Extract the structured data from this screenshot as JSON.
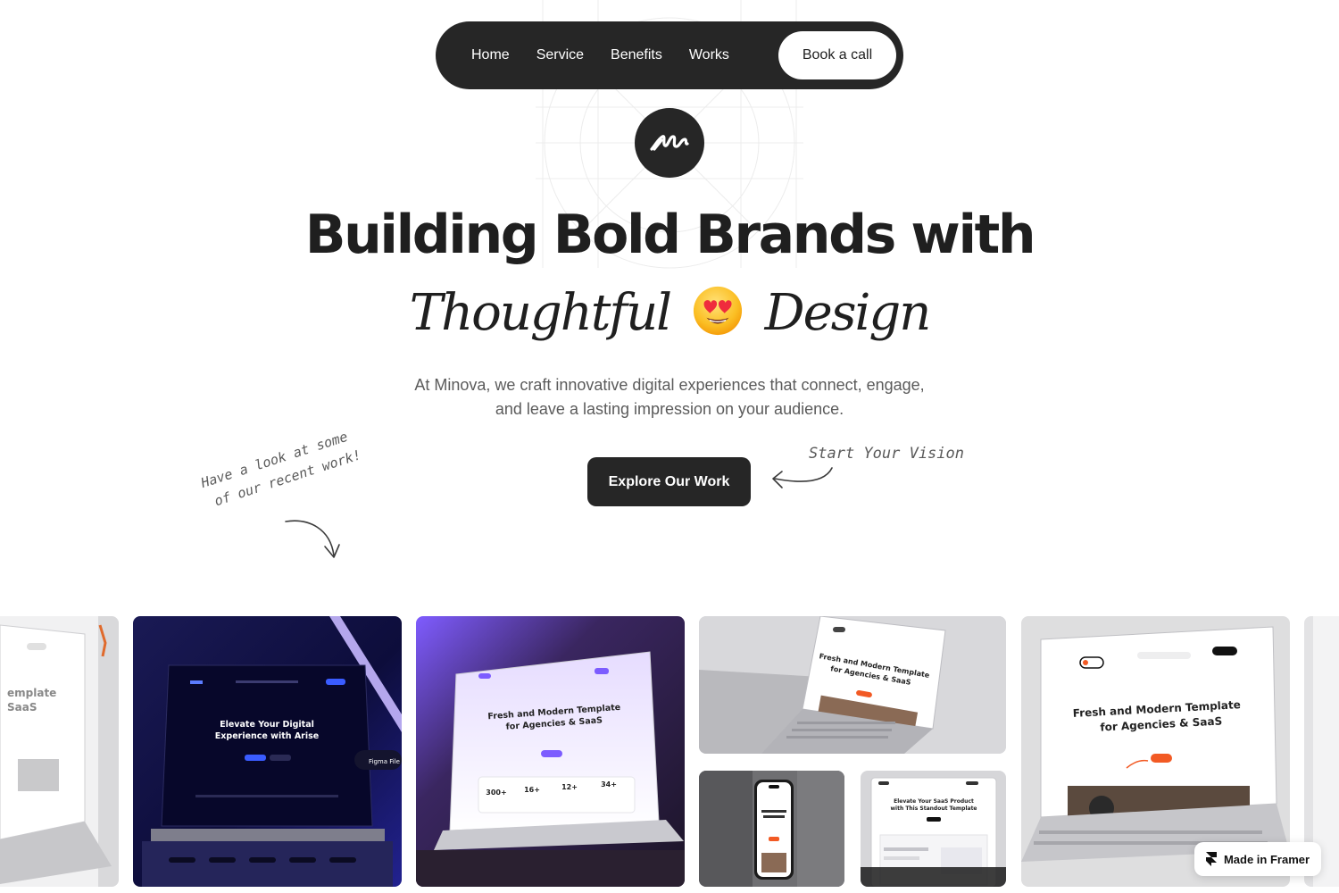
{
  "nav": {
    "links": [
      "Home",
      "Service",
      "Benefits",
      "Works"
    ],
    "cta": "Book a call"
  },
  "logo": {
    "icon": "wave-logo-icon"
  },
  "hero": {
    "headline_line1": "Building Bold Brands with",
    "headline_word1": "Thoughtful",
    "headline_emoji": "heart-eyes-emoji",
    "headline_word2": "Design",
    "subtitle": "At Minova, we craft innovative digital experiences that connect, engage, and leave a lasting impression on your audience.",
    "cta": "Explore Our Work",
    "note_right": "Start Your Vision",
    "note_left_line1": "Have a look at some",
    "note_left_line2": "of our recent work!"
  },
  "gallery": {
    "card_arise": {
      "headline_line1": "Elevate Your Digital",
      "headline_line2": "Experience with Arise",
      "badge": "Figma File"
    },
    "card_ember": {
      "headline_line1": "Fresh and Modern Template",
      "headline_line2": "for Agencies & SaaS",
      "stats": [
        "300+",
        "16+",
        "12+",
        "34+"
      ]
    },
    "card_laptop_top": {
      "headline_line1": "Fresh and Modern Template",
      "headline_line2": "for Agencies & SaaS"
    },
    "card_dashboard": {
      "headline_line1": "Elevate Your SaaS Product",
      "headline_line2": "with This Standout Template"
    },
    "card_clever": {
      "headline_line1": "Fresh and Modern Template",
      "headline_line2": "for Agencies & SaaS"
    },
    "card_edge_left": {
      "text_line1": "emplate",
      "text_line2": "SaaS"
    }
  },
  "badge": {
    "label": "Made in Framer",
    "icon": "framer-icon"
  },
  "colors": {
    "dark": "#262626",
    "accent_purple": "#6b4bff",
    "accent_orange": "#f25a24"
  }
}
